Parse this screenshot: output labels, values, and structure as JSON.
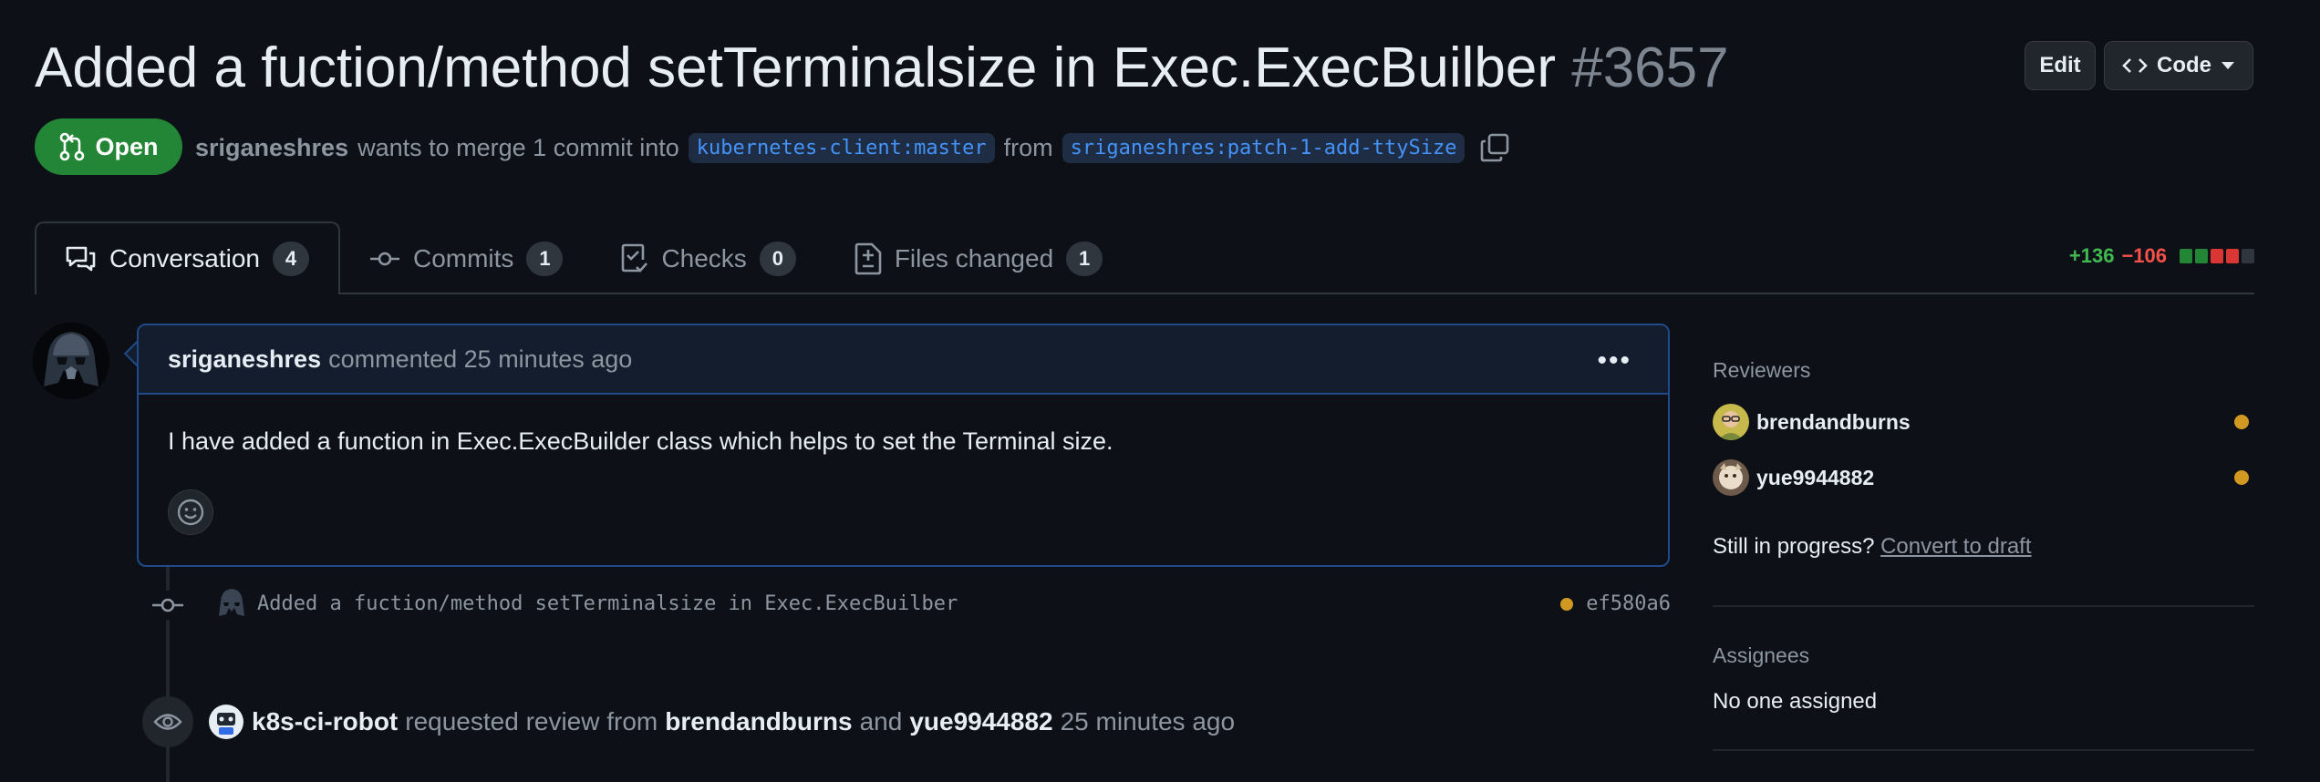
{
  "pr": {
    "title": "Added a fuction/method setTerminalsize in Exec.ExecBuilber",
    "number": "#3657",
    "state": "Open",
    "author": "sriganeshres",
    "merge_text": "wants to merge 1 commit into",
    "base_branch": "kubernetes-client:master",
    "from_text": "from",
    "head_branch": "sriganeshres:patch-1-add-ttySize"
  },
  "header_buttons": {
    "edit": "Edit",
    "code": "Code"
  },
  "tabs": [
    {
      "label": "Conversation",
      "count": "4",
      "icon": "comment-discussion-icon"
    },
    {
      "label": "Commits",
      "count": "1",
      "icon": "git-commit-icon"
    },
    {
      "label": "Checks",
      "count": "0",
      "icon": "checklist-icon"
    },
    {
      "label": "Files changed",
      "count": "1",
      "icon": "file-diff-icon"
    }
  ],
  "diffstat": {
    "additions": "+136",
    "deletions": "−106"
  },
  "comment": {
    "author": "sriganeshres",
    "meta": "commented 25 minutes ago",
    "body": "I have added a function in Exec.ExecBuilder class which helps to set the Terminal size."
  },
  "commit": {
    "message": "Added a fuction/method setTerminalsize in Exec.ExecBuilber",
    "sha": "ef580a6"
  },
  "review_event": {
    "actor": "k8s-ci-robot",
    "text1": "requested review from",
    "reviewer1": "brendandburns",
    "and": "and",
    "reviewer2": "yue9944882",
    "time": "25 minutes ago"
  },
  "sidebar": {
    "reviewers_heading": "Reviewers",
    "reviewers": [
      "brendandburns",
      "yue9944882"
    ],
    "in_progress": "Still in progress?",
    "convert_link": "Convert to draft",
    "assignees_heading": "Assignees",
    "assignees_value": "No one assigned"
  },
  "colors": {
    "background": "#0d1117",
    "open_badge": "#238636",
    "link": "#4493f8",
    "pending_dot": "#d29922",
    "additions": "#3fb950",
    "deletions": "#f85149"
  }
}
